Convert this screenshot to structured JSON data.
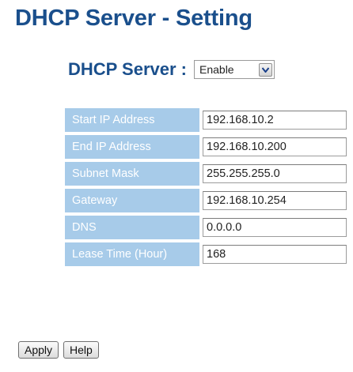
{
  "page": {
    "title": "DHCP Server - Setting"
  },
  "server": {
    "label": "DHCP Server :",
    "selected": "Enable"
  },
  "fields": [
    {
      "label": "Start IP Address",
      "value": "192.168.10.2"
    },
    {
      "label": "End IP Address",
      "value": "192.168.10.200"
    },
    {
      "label": "Subnet Mask",
      "value": "255.255.255.0"
    },
    {
      "label": "Gateway",
      "value": "192.168.10.254"
    },
    {
      "label": "DNS",
      "value": "0.0.0.0"
    },
    {
      "label": "Lease Time (Hour)",
      "value": "168"
    }
  ],
  "buttons": {
    "apply": "Apply",
    "help": "Help"
  },
  "colors": {
    "title": "#1a4f8c",
    "label_bg": "#a7cbe9",
    "label_text": "#ffffff"
  },
  "icons": {
    "dropdown": "chevron-down-icon"
  }
}
